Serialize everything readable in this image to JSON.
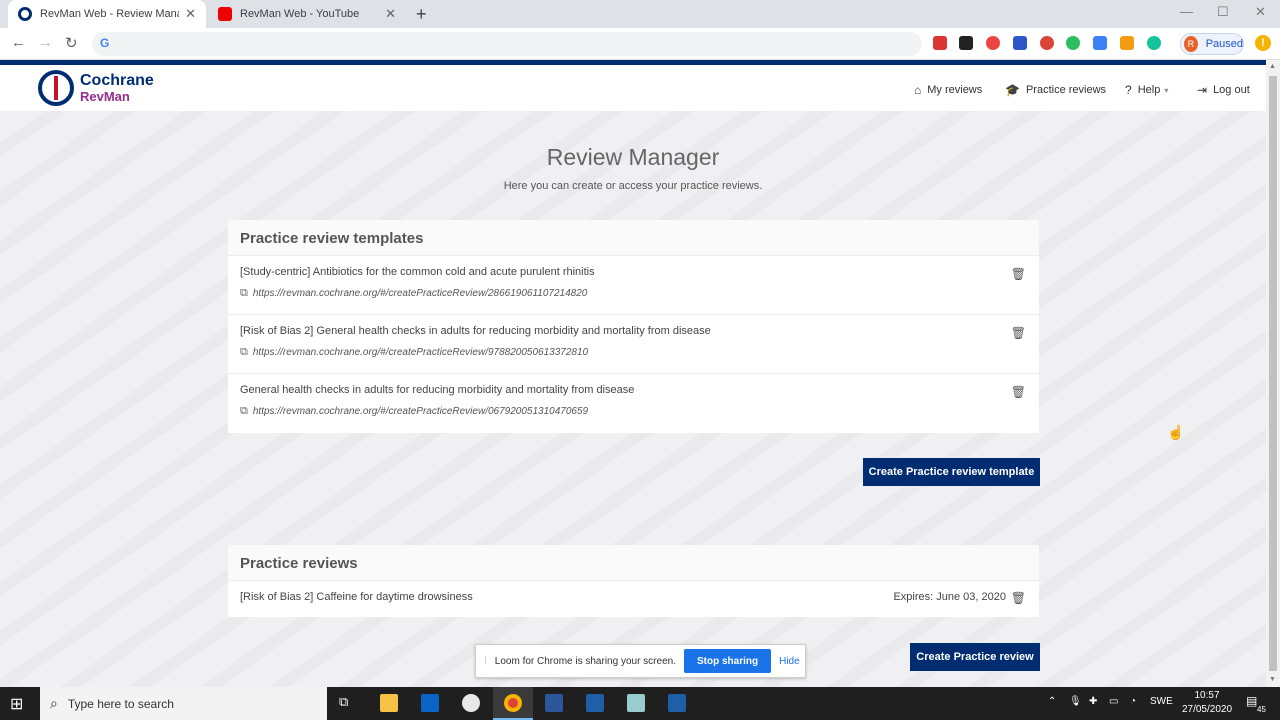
{
  "browser": {
    "tabs": [
      {
        "label": "RevMan Web - Review Manager",
        "active": true
      },
      {
        "label": "RevMan Web - YouTube",
        "active": false
      }
    ],
    "profile_initial": "R",
    "profile_status": "Paused"
  },
  "app": {
    "logo_line1": "Cochrane",
    "logo_line2": "RevMan",
    "nav": {
      "my_reviews": "My reviews",
      "practice_reviews": "Practice reviews",
      "help": "Help",
      "logout": "Log out"
    }
  },
  "page": {
    "title": "Review Manager",
    "subtitle": "Here you can create or access your practice reviews."
  },
  "templates": {
    "heading": "Practice review templates",
    "items": [
      {
        "title": "[Study-centric] Antibiotics for the common cold and acute purulent rhinitis",
        "url": "https://revman.cochrane.org/#/createPracticeReview/286619061107214820"
      },
      {
        "title": "[Risk of Bias 2] General health checks in adults for reducing morbidity and mortality from disease",
        "url": "https://revman.cochrane.org/#/createPracticeReview/978820050613372810"
      },
      {
        "title": "General health checks in adults for reducing morbidity and mortality from disease",
        "url": "https://revman.cochrane.org/#/createPracticeReview/067920051310470659"
      }
    ],
    "create_button": "Create Practice review template"
  },
  "reviews": {
    "heading": "Practice reviews",
    "items": [
      {
        "title": "[Risk of Bias 2] Caffeine for daytime drowsiness",
        "expires": "Expires: June 03, 2020"
      }
    ],
    "create_button": "Create Practice review"
  },
  "loom": {
    "message": "Loom for Chrome is sharing your screen.",
    "stop": "Stop sharing",
    "hide": "Hide"
  },
  "taskbar": {
    "search_placeholder": "Type here to search",
    "lang": "SWE",
    "time": "10:57",
    "date": "27/05/2020",
    "notifications": "45"
  },
  "colors": {
    "brand_navy": "#002d72",
    "brand_purple": "#962d8f",
    "loom_blue": "#1a73e8"
  }
}
